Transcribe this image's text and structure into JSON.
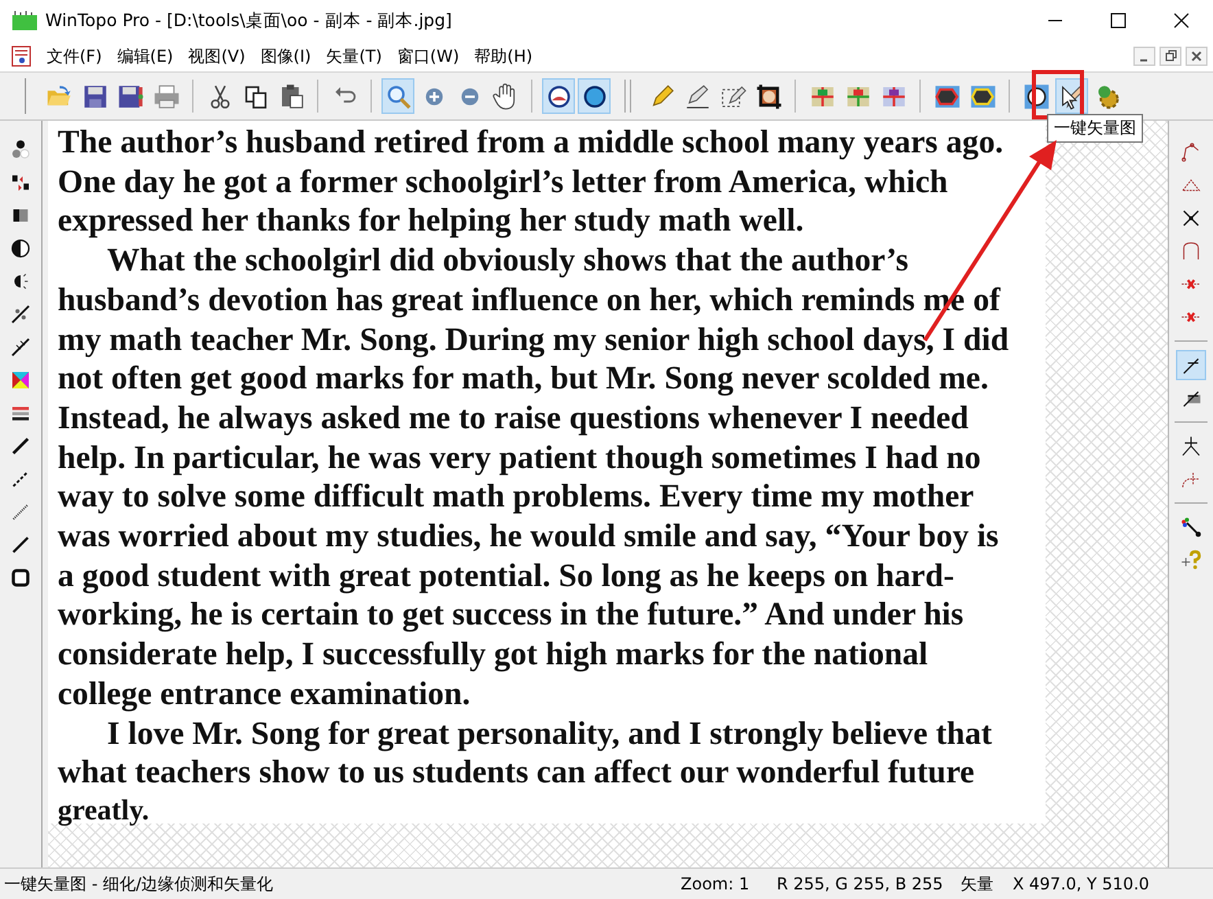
{
  "window": {
    "title": "WinTopo Pro - [D:\\tools\\桌面\\oo - 副本 - 副本.jpg]"
  },
  "menu": [
    "文件(F)",
    "编辑(E)",
    "视图(V)",
    "图像(I)",
    "矢量(T)",
    "窗口(W)",
    "帮助(H)"
  ],
  "toolbar": {
    "groups": [
      [
        {
          "selected": false
        },
        {
          "selected": false
        },
        {
          "selected": false
        },
        {
          "selected": false
        }
      ],
      [
        {
          "selected": false
        },
        {
          "selected": false
        },
        {
          "selected": false
        }
      ],
      [
        {
          "selected": false
        }
      ],
      [
        {
          "selected": true
        },
        {
          "selected": false
        },
        {
          "selected": false
        },
        {
          "selected": false
        }
      ],
      [
        {
          "selected": true
        },
        {
          "selected": true
        }
      ],
      [
        {
          "selected": false
        },
        {
          "selected": false
        },
        {
          "selected": false
        },
        {
          "selected": false
        }
      ],
      [
        {
          "selected": false
        },
        {
          "selected": false
        },
        {
          "selected": false
        }
      ],
      [
        {
          "selected": false
        },
        {
          "selected": false
        }
      ],
      [
        {
          "selected": false
        },
        {
          "selected": true
        },
        {
          "selected": false
        }
      ]
    ]
  },
  "tooltip": "一键矢量图",
  "left_tools": [
    {
      "selected": false
    },
    {
      "selected": false
    },
    {
      "selected": false
    },
    {
      "selected": false
    },
    {
      "selected": false
    },
    {
      "selected": false
    },
    {
      "selected": false
    },
    {
      "selected": false
    },
    {
      "selected": false
    },
    {
      "selected": false
    },
    {
      "selected": false
    },
    {
      "selected": false
    },
    {
      "selected": false
    },
    {
      "selected": false
    }
  ],
  "right_tools": {
    "groups": [
      [
        {
          "selected": false
        },
        {
          "selected": false
        },
        {
          "selected": false
        },
        {
          "selected": false
        },
        {
          "selected": false
        },
        {
          "selected": false
        }
      ],
      [
        {
          "selected": true
        },
        {
          "selected": false
        }
      ],
      [
        {
          "selected": false
        },
        {
          "selected": false
        }
      ],
      [
        {
          "selected": false
        },
        {
          "selected": false
        }
      ]
    ]
  },
  "document": {
    "lines": [
      {
        "text": "The author’s husband retired from a middle school many years ago.",
        "kind": "line"
      },
      {
        "text": "One day he got a former schoolgirl’s letter from America, which",
        "kind": "line"
      },
      {
        "text": "expressed her thanks for helping her study math well.",
        "kind": "line"
      },
      {
        "text": "What the schoolgirl did obviously shows that the author’s",
        "kind": "indent"
      },
      {
        "text": "husband’s devotion has great influence on her, which reminds me of",
        "kind": "line"
      },
      {
        "text": "my math teacher Mr. Song. During my senior high school days, I did",
        "kind": "line"
      },
      {
        "text": "not often get good marks for math, but Mr. Song never scolded me.",
        "kind": "line"
      },
      {
        "text": "Instead, he always asked me to raise questions whenever I needed",
        "kind": "line"
      },
      {
        "text": "help. In particular, he was very patient though sometimes I had no",
        "kind": "line"
      },
      {
        "text": "way to solve some difficult math problems. Every time my mother",
        "kind": "line"
      },
      {
        "text": "was worried about my studies, he would smile and say, “Your boy is",
        "kind": "line"
      },
      {
        "text": "a good student with great potential. So long as he keeps on hard-",
        "kind": "line"
      },
      {
        "text": "working, he is certain to get success in the future.” And under his",
        "kind": "line"
      },
      {
        "text": "considerate help, I successfully got high marks for the national",
        "kind": "line"
      },
      {
        "text": "college entrance examination.",
        "kind": "line"
      },
      {
        "text": "I love Mr. Song for great personality, and I strongly believe that",
        "kind": "indent"
      },
      {
        "text": "what teachers show to us students can affect our wonderful future",
        "kind": "line"
      },
      {
        "text": "greatly.",
        "kind": "small"
      }
    ]
  },
  "status_bar": {
    "message": "一键矢量图 - 细化/边缘侦测和矢量化",
    "zoom": "Zoom: 1",
    "rgb_value": "R 255, G 255, B 255",
    "mode": "矢量",
    "position": "X 497.0, Y 510.0"
  }
}
